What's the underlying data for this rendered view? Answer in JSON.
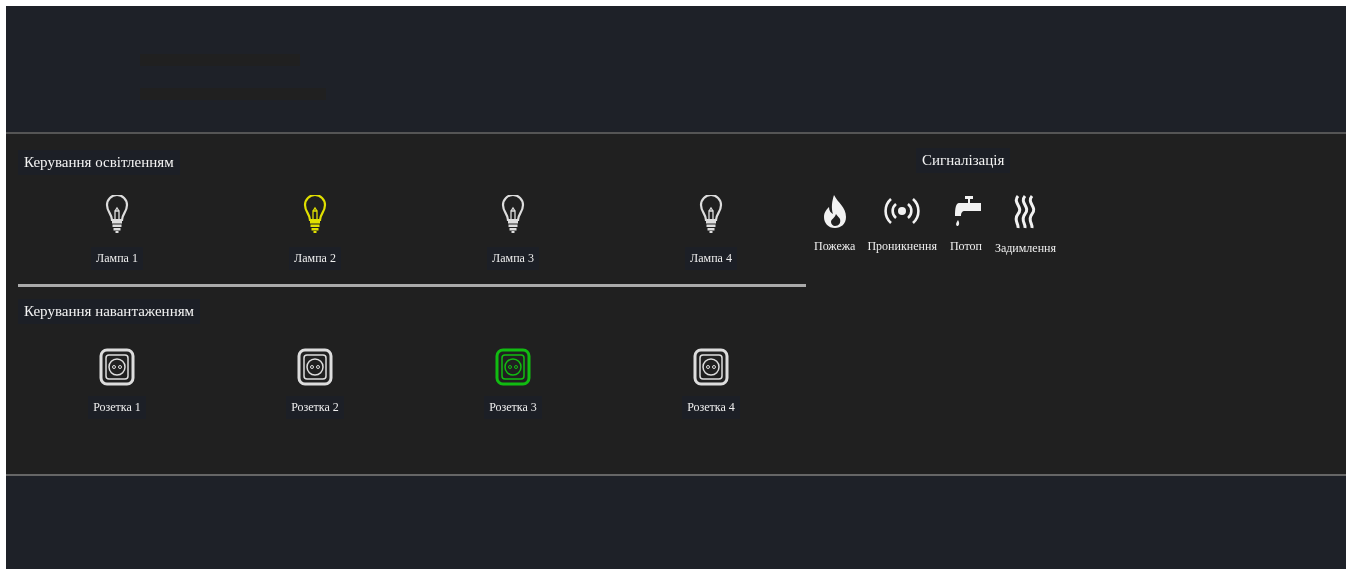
{
  "lighting": {
    "title": "Керування освітленням",
    "lamps": [
      {
        "label": "Лампа 1",
        "on": false
      },
      {
        "label": "Лампа 2",
        "on": true
      },
      {
        "label": "Лампа 3",
        "on": false
      },
      {
        "label": "Лампа 4",
        "on": false
      }
    ]
  },
  "load": {
    "title": "Керування навантаженням",
    "sockets": [
      {
        "label": "Розетка 1",
        "on": false
      },
      {
        "label": "Розетка 2",
        "on": false
      },
      {
        "label": "Розетка 3",
        "on": true
      },
      {
        "label": "Розетка 4",
        "on": false
      }
    ]
  },
  "alarms": {
    "title": "Сигналізація",
    "items": [
      {
        "kind": "fire",
        "label": "Пожежа"
      },
      {
        "kind": "intrusion",
        "label": "Проникнення"
      },
      {
        "kind": "flood",
        "label": "Потоп"
      },
      {
        "kind": "smoke",
        "label": "Задимлення"
      }
    ]
  }
}
